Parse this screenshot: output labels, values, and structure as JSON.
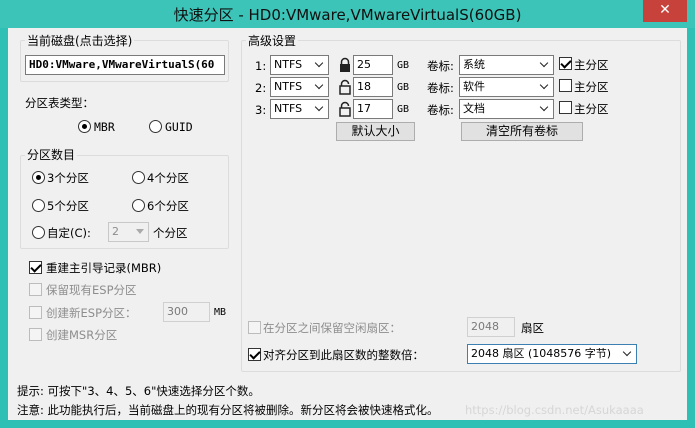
{
  "window": {
    "title": "快速分区 - HD0:VMware,VMwareVirtualS(60GB)",
    "close_label": "✕"
  },
  "disk": {
    "group_title": "当前磁盘(点击选择)",
    "value": "HD0:VMware,VMwareVirtualS(60"
  },
  "partition_table": {
    "label": "分区表类型：",
    "mbr": "MBR",
    "guid": "GUID",
    "selected": "MBR"
  },
  "partition_count": {
    "group_title": "分区数目",
    "options": [
      "3个分区",
      "4个分区",
      "5个分区",
      "6个分区"
    ],
    "selected": "3个分区",
    "custom_label": "自定(C):",
    "custom_value": "2",
    "custom_suffix": "个分区"
  },
  "options": {
    "rebuild_mbr": "重建主引导记录(MBR)",
    "keep_esp": "保留现有ESP分区",
    "create_esp": "创建新ESP分区：",
    "esp_size": "300",
    "esp_unit": "MB",
    "create_msr": "创建MSR分区"
  },
  "advanced": {
    "group_title": "高级设置",
    "volume_label_text": "卷标:",
    "primary_text": "主分区",
    "unit": "GB",
    "rows": [
      {
        "index": "1:",
        "fs": "NTFS",
        "size": "25",
        "volume": "系统",
        "primary": true
      },
      {
        "index": "2:",
        "fs": "NTFS",
        "size": "18",
        "volume": "软件",
        "primary": false
      },
      {
        "index": "3:",
        "fs": "NTFS",
        "size": "17",
        "volume": "文档",
        "primary": false
      }
    ],
    "default_size_button": "默认大小",
    "clear_labels_button": "清空所有卷标"
  },
  "alignment": {
    "reserve_label": "在分区之间保留空闲扇区：",
    "reserve_value": "2048",
    "reserve_unit": "扇区",
    "align_label": "对齐分区到此扇区数的整数倍：",
    "align_value": "2048 扇区 (1048576 字节)"
  },
  "footer": {
    "hint": "提示: 可按下\"3、4、5、6\"快速选择分区个数。",
    "warning": "注意: 此功能执行后，当前磁盘上的现有分区将被删除。新分区将会被快速格式化。",
    "watermark": "https://blog.csdn.net/Asukaaaa"
  },
  "colors": {
    "titlebar": "#3cc4b9",
    "close": "#c7423a",
    "dialog_bg": "#f0f0f0"
  }
}
